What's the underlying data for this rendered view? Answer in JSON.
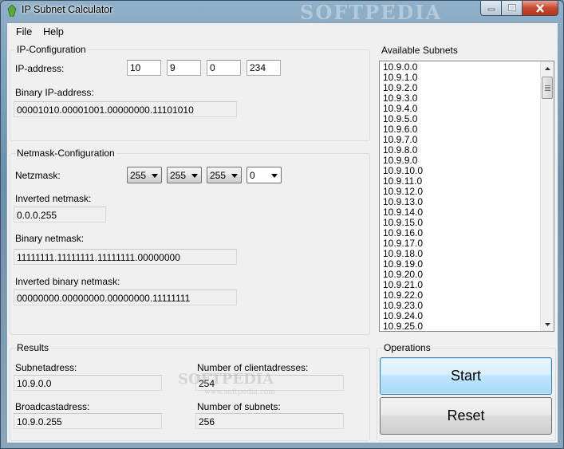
{
  "window": {
    "title": "IP Subnet Calculator",
    "watermark": "SOFTPEDIA"
  },
  "menu": {
    "file": "File",
    "help": "Help"
  },
  "ip_config": {
    "title": "IP-Configuration",
    "ip_label": "IP-address:",
    "octets": [
      "10",
      "9",
      "0",
      "234"
    ],
    "binary_label": "Binary IP-address:",
    "binary_value": "00001010.00001001.00000000.11101010"
  },
  "netmask_config": {
    "title": "Netmask-Configuration",
    "netmask_label": "Netzmask:",
    "octets": [
      "255",
      "255",
      "255",
      "0"
    ],
    "inverted_label": "Inverted netmask:",
    "inverted_value": "0.0.0.255",
    "binary_label": "Binary netmask:",
    "binary_value": "11111111.11111111.11111111.00000000",
    "inverted_binary_label": "Inverted binary netmask:",
    "inverted_binary_value": "00000000.00000000.00000000.11111111"
  },
  "subnets": {
    "title": "Available Subnets",
    "items": [
      "10.9.0.0",
      "10.9.1.0",
      "10.9.2.0",
      "10.9.3.0",
      "10.9.4.0",
      "10.9.5.0",
      "10.9.6.0",
      "10.9.7.0",
      "10.9.8.0",
      "10.9.9.0",
      "10.9.10.0",
      "10.9.11.0",
      "10.9.12.0",
      "10.9.13.0",
      "10.9.14.0",
      "10.9.15.0",
      "10.9.16.0",
      "10.9.17.0",
      "10.9.18.0",
      "10.9.19.0",
      "10.9.20.0",
      "10.9.21.0",
      "10.9.22.0",
      "10.9.23.0",
      "10.9.24.0",
      "10.9.25.0"
    ]
  },
  "results": {
    "title": "Results",
    "subnet_label": "Subnetadress:",
    "subnet_value": "10.9.0.0",
    "broadcast_label": "Broadcastadress:",
    "broadcast_value": "10.9.0.255",
    "clients_label": "Number of clientadresses:",
    "clients_value": "254",
    "subnets_label": "Number of subnets:",
    "subnets_value": "256",
    "watermark": "SOFTPEDIA",
    "watermark_url": "www.softpedia.com"
  },
  "operations": {
    "title": "Operations",
    "start": "Start",
    "reset": "Reset"
  }
}
